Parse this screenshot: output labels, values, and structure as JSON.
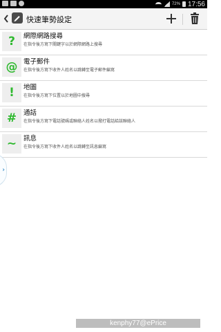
{
  "status_bar": {
    "battery_percent": "72%",
    "time": "17:56",
    "icons": [
      "image-icon",
      "image-icon",
      "circle-icon",
      "wifi-icon",
      "signal-icon",
      "battery-icon"
    ]
  },
  "action_bar": {
    "title": "快速筆勢設定",
    "icons": [
      "back-arrow-icon",
      "app-icon",
      "plus-icon",
      "trash-icon"
    ]
  },
  "items": [
    {
      "glyph": "?",
      "title": "網際網路搜尋",
      "subtitle": "在指令後方寫下關鍵字以於網際網路上搜尋"
    },
    {
      "glyph": "@",
      "title": "電子郵件",
      "subtitle": "在指令後方寫下收件人姓名以跳轉至電子郵件編寫"
    },
    {
      "glyph": "!",
      "title": "地圖",
      "subtitle": "在指令後方寫下位置以於地圖中搜尋"
    },
    {
      "glyph": "#",
      "title": "通話",
      "subtitle": "在指令後方寫下電話號碼或聯絡人姓名以撥打電話給該聯絡人"
    },
    {
      "glyph": "~",
      "title": "訊息",
      "subtitle": "在指令後方寫下收件人姓名以跳轉至訊息編寫"
    }
  ],
  "side_handle": {
    "glyph": "›"
  },
  "watermark": "kenphy77@ePrice",
  "colors": {
    "accent_green": "#2fb92f",
    "status_bar_bg": "#000000",
    "action_bar_bg": "#f4f4f4"
  }
}
